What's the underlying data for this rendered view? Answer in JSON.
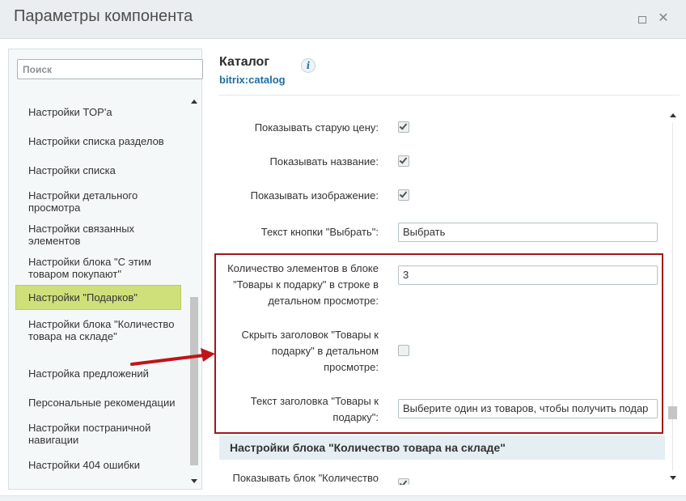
{
  "window": {
    "title": "Параметры компонента"
  },
  "sidebar": {
    "search_placeholder": "Поиск",
    "items": [
      {
        "label": "Настройки TOP'a"
      },
      {
        "label": "Настройки списка разделов"
      },
      {
        "label": "Настройки списка"
      },
      {
        "label": "Настройки детального просмотра"
      },
      {
        "label": "Настройки связанных элементов"
      },
      {
        "label": "Настройки блока \"С этим товаром покупают\""
      },
      {
        "label": "Настройки \"Подарков\""
      },
      {
        "label": "Настройки блока \"Количество товара на складе\""
      },
      {
        "label": "Настройка предложений"
      },
      {
        "label": "Персональные рекомендации"
      },
      {
        "label": "Настройки постраничной навигации"
      },
      {
        "label": "Настройки 404 ошибки"
      }
    ],
    "active_index": 6
  },
  "component": {
    "title": "Каталог",
    "code": "bitrix:catalog",
    "info_icon": "info-icon"
  },
  "params": [
    {
      "label": "Показывать старую цену:",
      "type": "checkbox",
      "checked": true
    },
    {
      "label": "Показывать название:",
      "type": "checkbox",
      "checked": true
    },
    {
      "label": "Показывать изображение:",
      "type": "checkbox",
      "checked": true
    },
    {
      "label": "Текст кнопки \"Выбрать\":",
      "type": "text",
      "value": "Выбрать"
    },
    {
      "label": "Количество элементов в блоке \"Товары к подарку\" в строке в детальном просмотре:",
      "type": "text",
      "value": "3"
    },
    {
      "label": "Скрыть заголовок \"Товары к подарку\" в детальном просмотре:",
      "type": "checkbox",
      "checked": false
    },
    {
      "label": "Текст заголовка \"Товары к подарку\":",
      "type": "text",
      "value": "Выберите один из товаров, чтобы получить подар"
    }
  ],
  "section": {
    "title": "Настройки блока \"Количество товара на складе\""
  },
  "next_param": {
    "label": "Показывать блок \"Количество",
    "type": "checkbox",
    "checked": true
  },
  "colors": {
    "accent": "#cfe07a",
    "highlight": "#a3161c",
    "link": "#1d6ea0"
  }
}
